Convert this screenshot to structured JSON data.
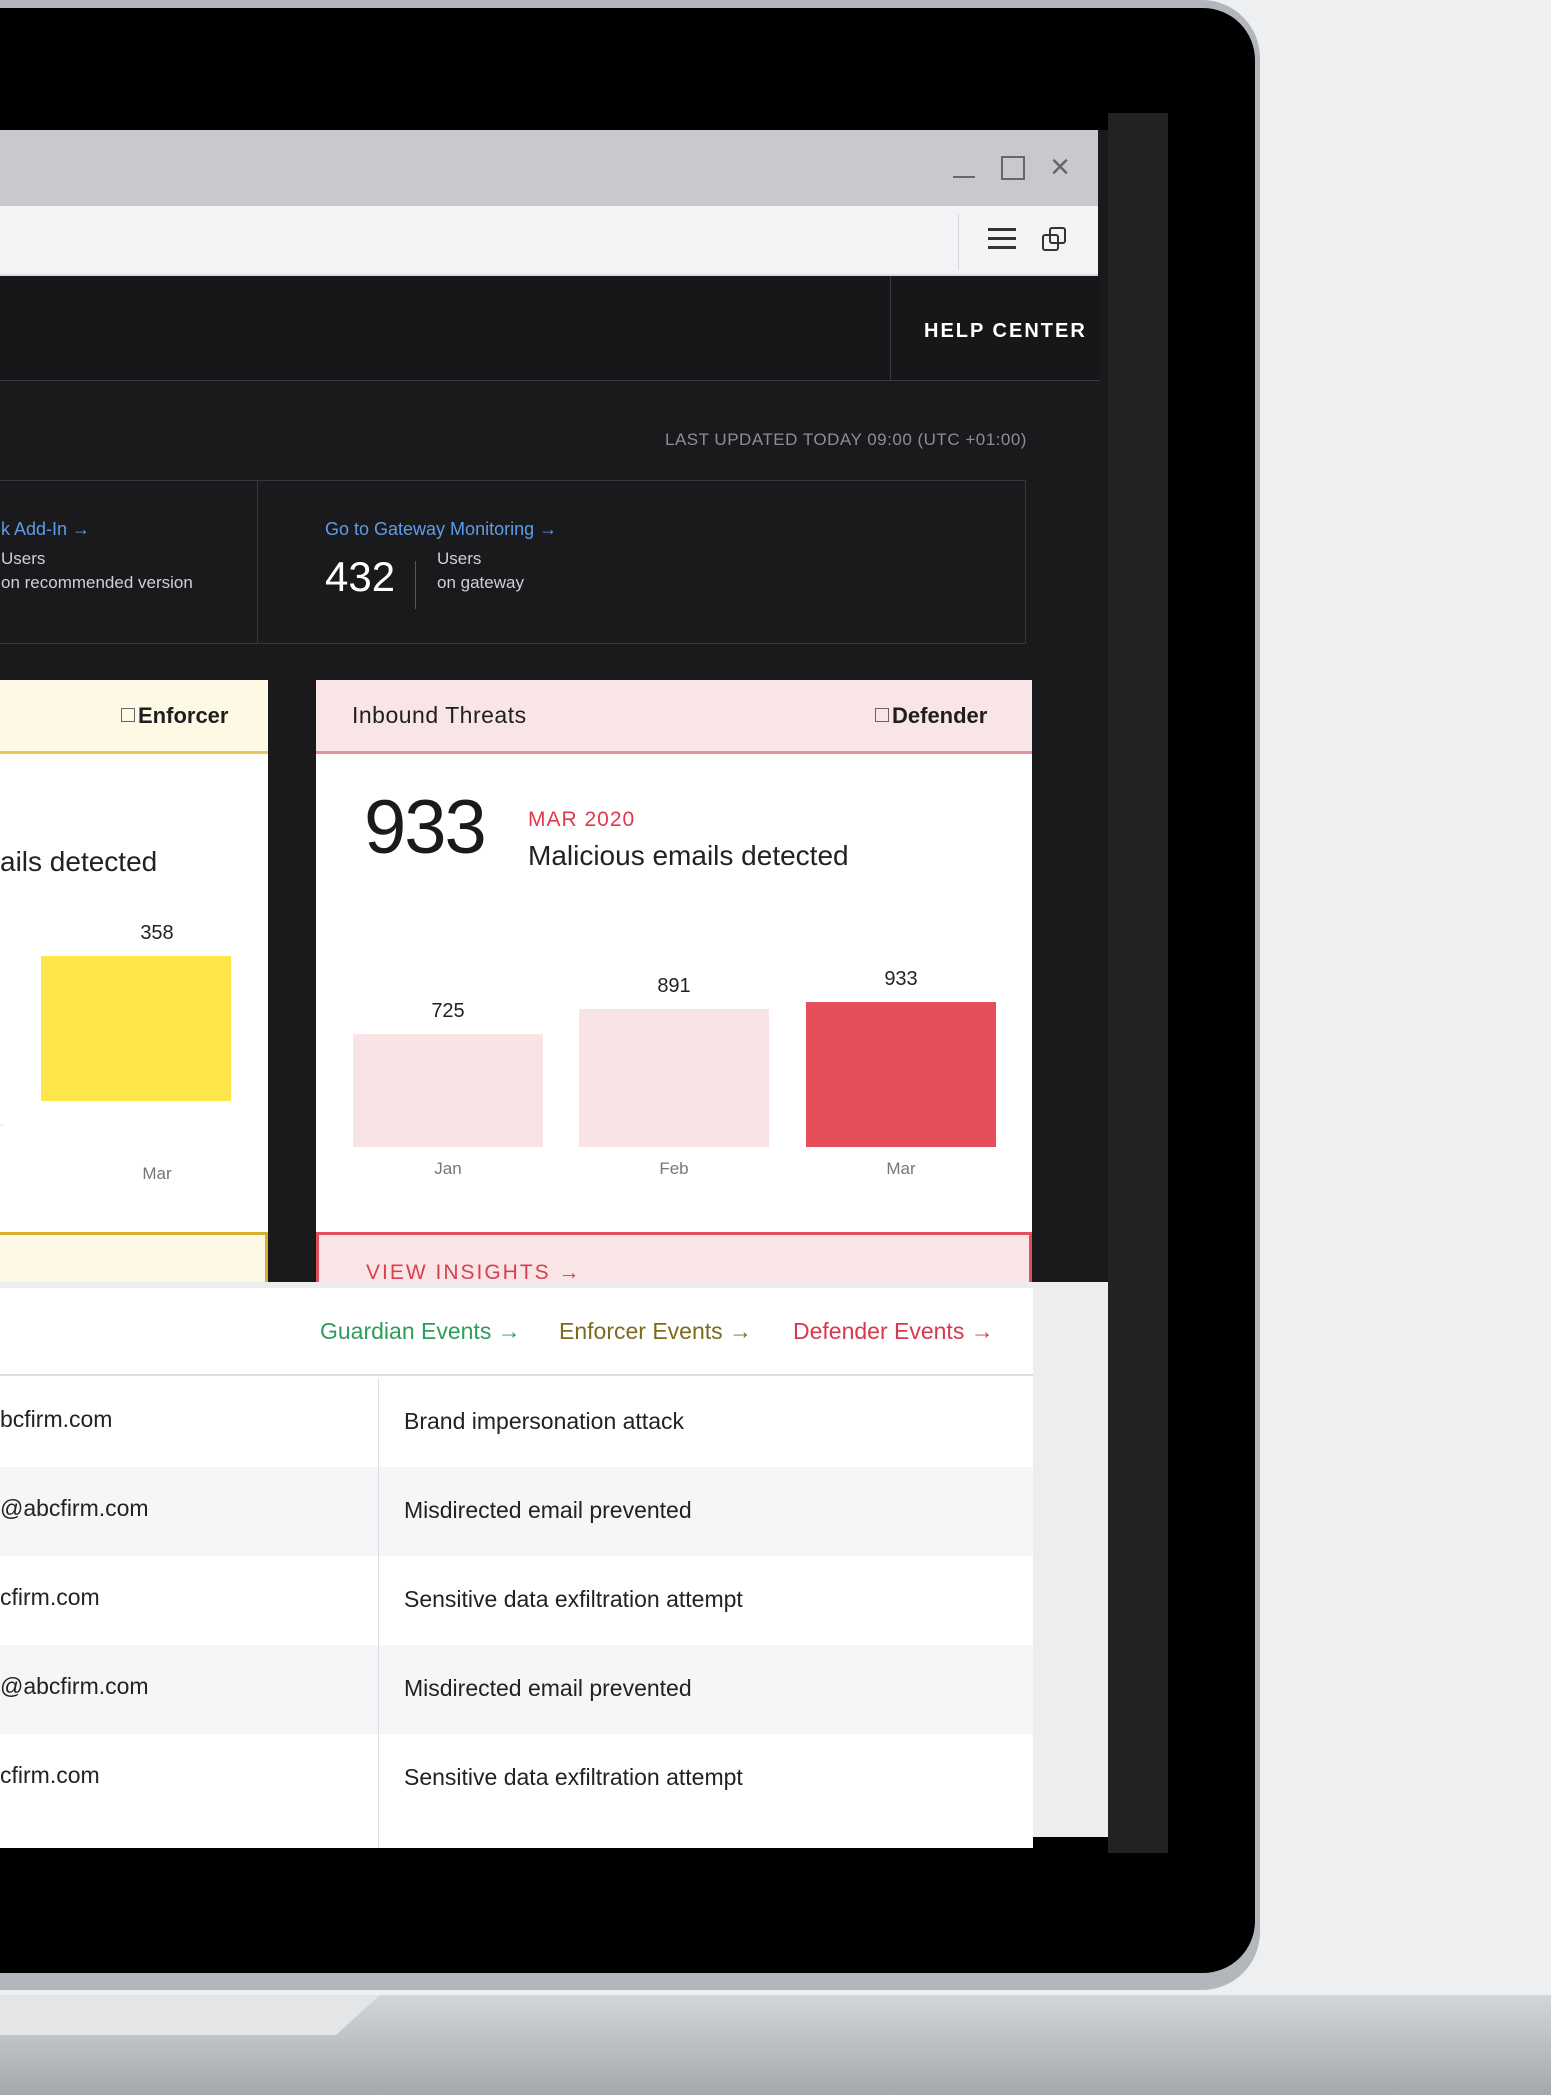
{
  "window": {
    "close_glyph": "×"
  },
  "header": {
    "help_center": "HELP CENTER"
  },
  "last_updated": "LAST UPDATED TODAY 09:00 (UTC +01:00)",
  "status": {
    "addin_link": "k Add-In →",
    "addin_label_1": "Users",
    "addin_label_2": "on recommended version",
    "gateway_link": "Go to Gateway Monitoring →",
    "gateway_count": "432",
    "gateway_label_1": "Users",
    "gateway_label_2": "on gateway"
  },
  "enforcer_card": {
    "badge": "Enforcer",
    "desc": "ails detected",
    "bar_value": "358",
    "bar_category": "Mar",
    "color": "#fde54a"
  },
  "defender_card": {
    "title": "Inbound Threats",
    "badge": "Defender",
    "big_number": "933",
    "month": "MAR 2020",
    "desc": "Malicious emails detected",
    "cta": "VIEW INSIGHTS →",
    "highlight_color": "#e64e5c",
    "muted_color": "#f8e3e5"
  },
  "chart_data": {
    "type": "bar",
    "categories": [
      "Jan",
      "Feb",
      "Mar"
    ],
    "values": [
      725,
      891,
      933
    ],
    "title": "Inbound Threats",
    "xlabel": "",
    "ylabel": ""
  },
  "events": {
    "links": [
      {
        "label": "Guardian Events →",
        "color": "#2e9c5a"
      },
      {
        "label": "Enforcer Events →",
        "color": "#7d6a1d"
      },
      {
        "label": "Defender Events →",
        "color": "#d9374b"
      }
    ],
    "rows": [
      {
        "email": "bcfirm.com",
        "event": "Brand impersonation attack"
      },
      {
        "email": "@abcfirm.com",
        "event": "Misdirected email prevented"
      },
      {
        "email": "cfirm.com",
        "event": "Sensitive data exfiltration attempt"
      },
      {
        "email": "@abcfirm.com",
        "event": "Misdirected email prevented"
      },
      {
        "email": "cfirm.com",
        "event": "Sensitive data exfiltration attempt"
      }
    ]
  }
}
